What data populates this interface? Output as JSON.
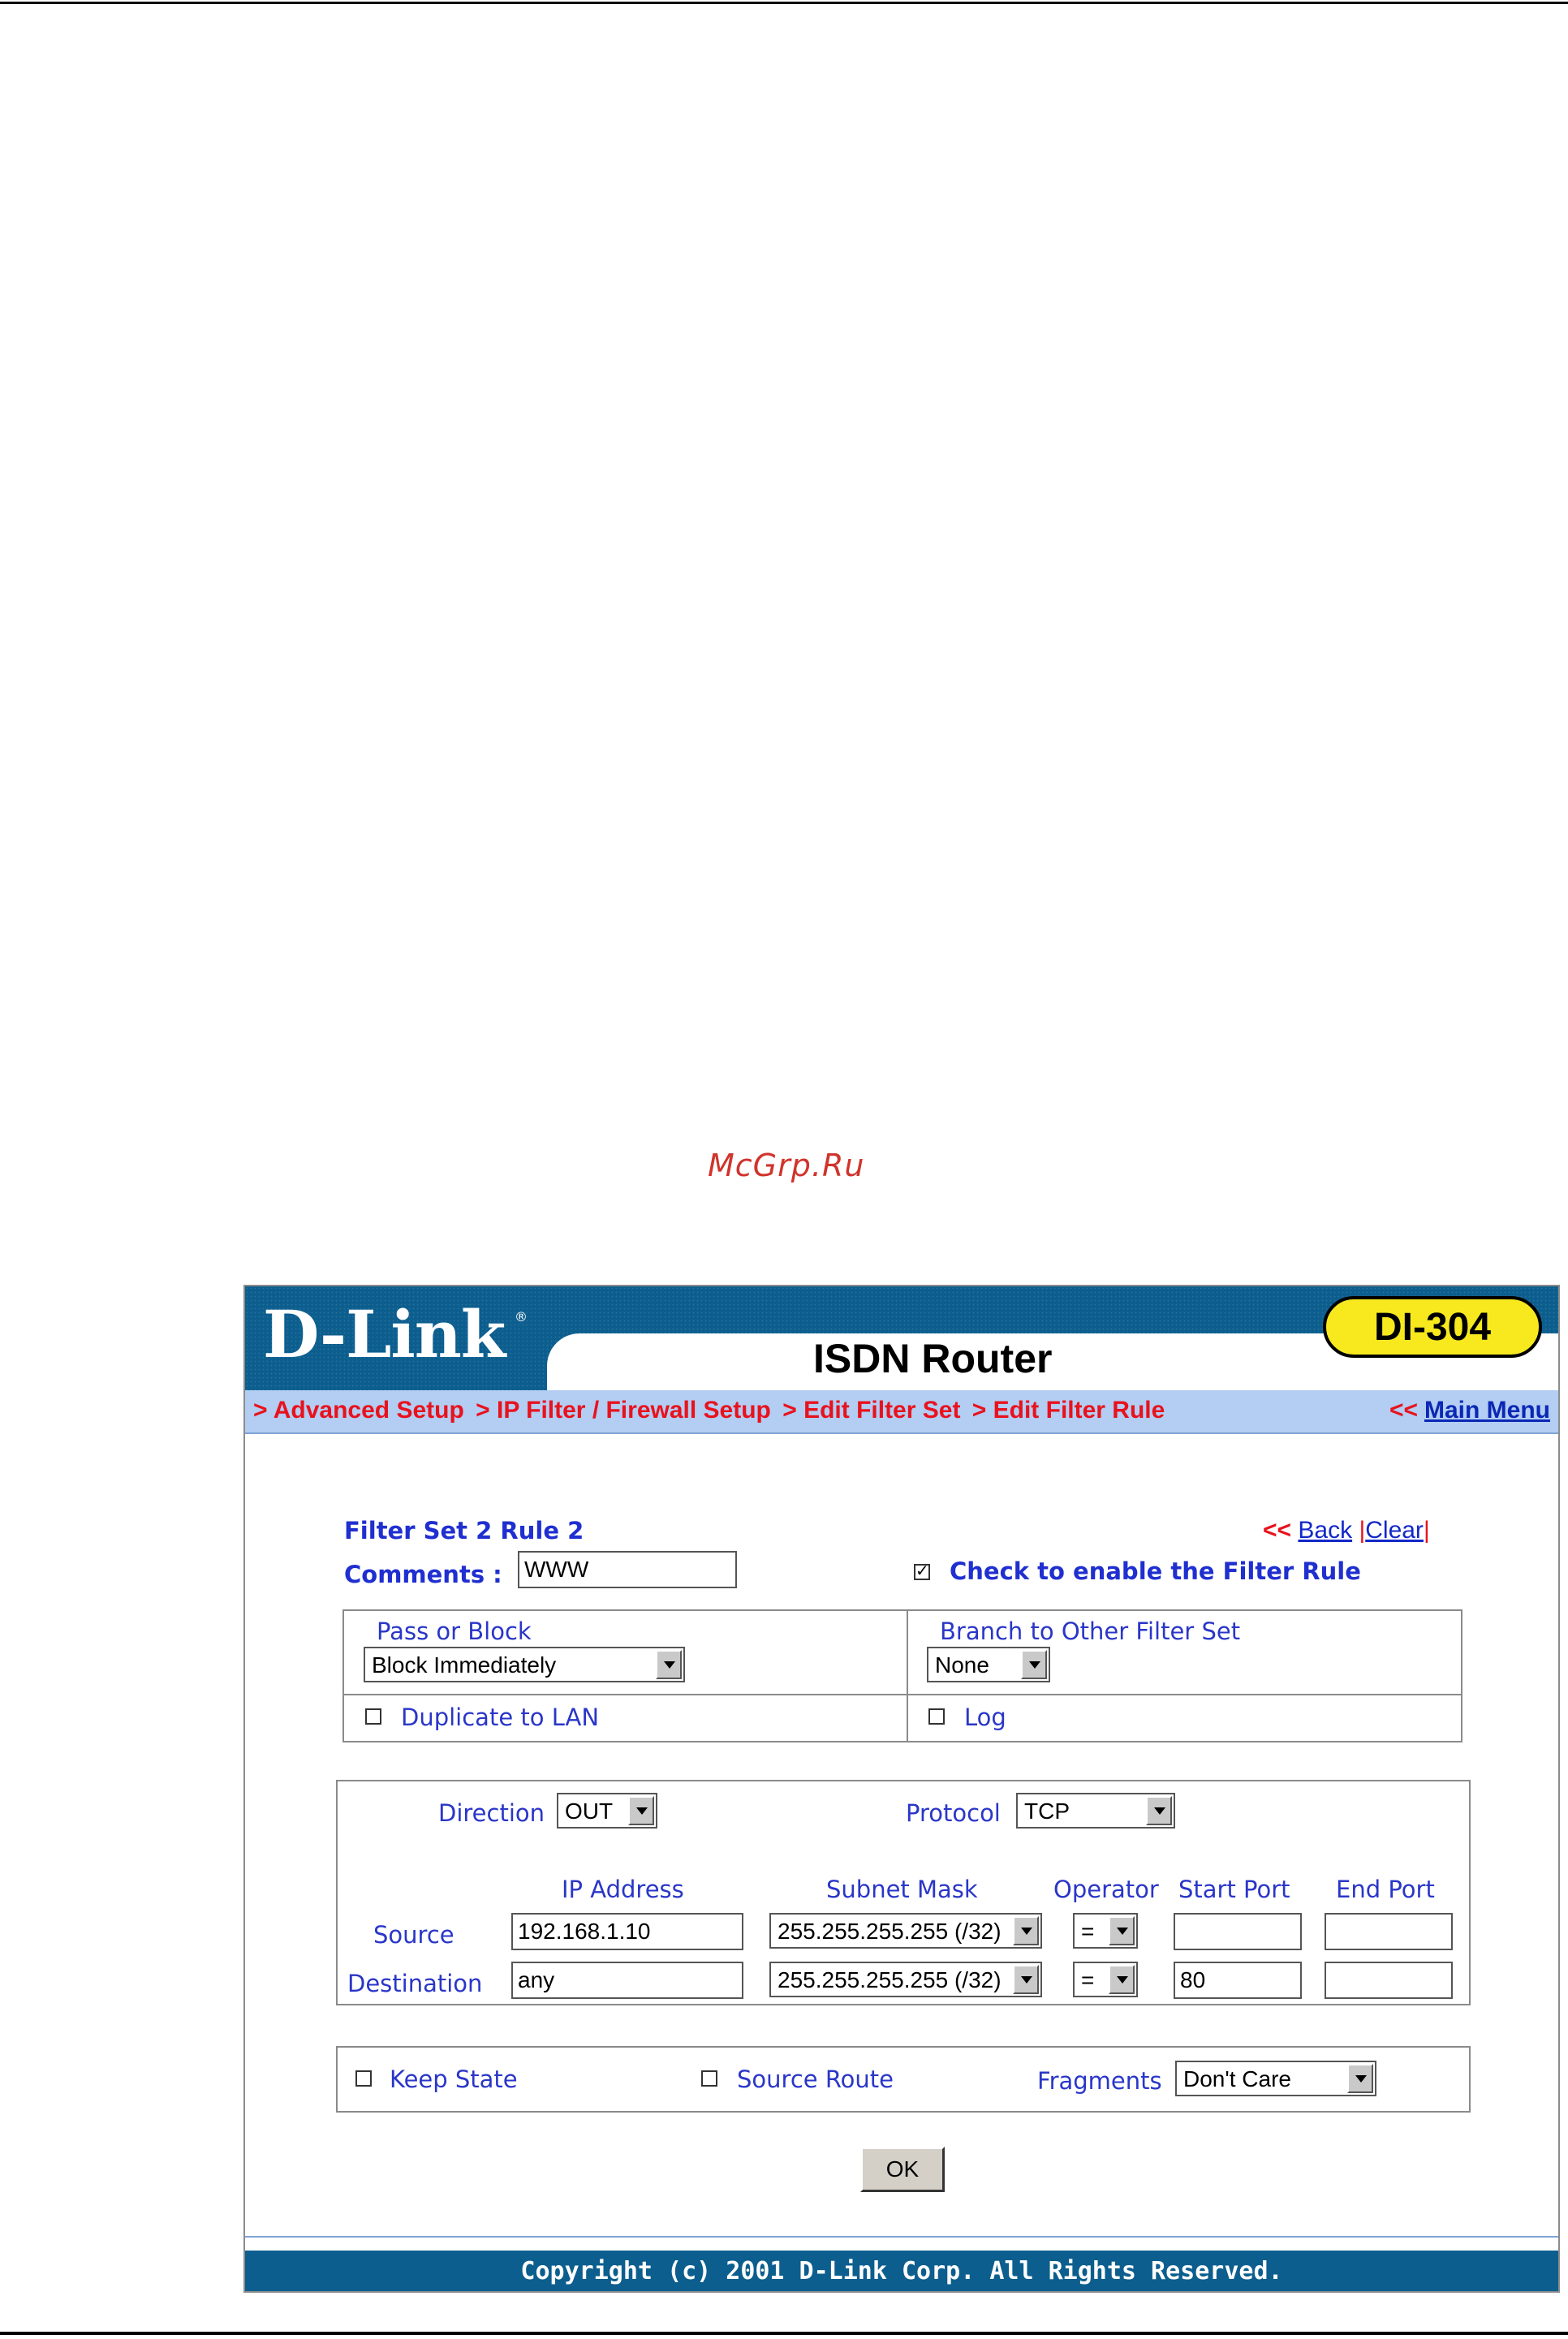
{
  "watermark": "McGrp.Ru",
  "header": {
    "logo": "D-Link",
    "registered": "®",
    "product": "ISDN Router",
    "model": "DI-304"
  },
  "breadcrumb": {
    "items": [
      "> Advanced Setup",
      "> IP Filter / Firewall Setup",
      "> Edit Filter Set",
      "> Edit Filter Rule"
    ],
    "main_menu_arrow": "<<",
    "main_menu_label": "Main Menu"
  },
  "rule": {
    "title": "Filter Set 2 Rule 2",
    "back_arrow": "<<",
    "back_label": "Back",
    "sep1": "|",
    "clear_label": "Clear",
    "sep2": "|",
    "comments_label": "Comments :",
    "comments_value": "WWW",
    "enable_label": "Check to enable the Filter Rule",
    "enable_checked": true
  },
  "action": {
    "pass_block_label": "Pass or Block",
    "pass_block_value": "Block Immediately",
    "branch_label": "Branch to Other Filter Set",
    "branch_value": "None",
    "duplicate_label": "Duplicate to LAN",
    "log_label": "Log"
  },
  "match": {
    "direction_label": "Direction",
    "direction_value": "OUT",
    "protocol_label": "Protocol",
    "protocol_value": "TCP",
    "col_ip": "IP Address",
    "col_mask": "Subnet Mask",
    "col_operator": "Operator",
    "col_start": "Start Port",
    "col_end": "End Port",
    "source": {
      "label": "Source",
      "ip": "192.168.1.10",
      "mask": "255.255.255.255 (/32)",
      "operator": "=",
      "start": "",
      "end": ""
    },
    "destination": {
      "label": "Destination",
      "ip": "any",
      "mask": "255.255.255.255 (/32)",
      "operator": "=",
      "start": "80",
      "end": ""
    }
  },
  "options": {
    "keep_state_label": "Keep State",
    "source_route_label": "Source Route",
    "fragments_label": "Fragments",
    "fragments_value": "Don't Care"
  },
  "ok_label": "OK",
  "footer": "Copyright (c) 2001 D-Link Corp. All Rights Reserved.",
  "colors": {
    "header_blue": "#0c5e8e",
    "breadcrumb_bg": "#b3cdf3",
    "breadcrumb_red": "#e8121d",
    "label_blue": "#2a36c8",
    "badge_yellow": "#f7e91d"
  }
}
